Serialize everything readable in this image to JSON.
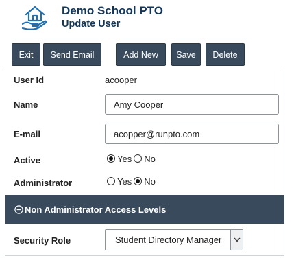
{
  "header": {
    "app_title": "Demo School PTO",
    "page_title": "Update User",
    "logo_icon": "house-hand-icon"
  },
  "toolbar": {
    "exit_label": "Exit",
    "send_email_label": "Send Email",
    "add_new_label": "Add New",
    "save_label": "Save",
    "delete_label": "Delete"
  },
  "form": {
    "user_id_label": "User Id",
    "user_id_value": "acooper",
    "name_label": "Name",
    "name_value": "Amy Cooper",
    "email_label": "E-mail",
    "email_value": "acopper@runpto.com",
    "active_label": "Active",
    "active_yes": "Yes",
    "active_no": "No",
    "active_selected": "Yes",
    "admin_label": "Administrator",
    "admin_yes": "Yes",
    "admin_no": "No",
    "admin_selected": "No"
  },
  "section": {
    "title": "Non Administrator Access Levels",
    "icon": "minus-circle-icon"
  },
  "access": {
    "security_role_label": "Security Role",
    "security_role_value": "Student Directory Manager"
  },
  "colors": {
    "title_blue": "#13375a",
    "button_bg": "#394a5c"
  }
}
